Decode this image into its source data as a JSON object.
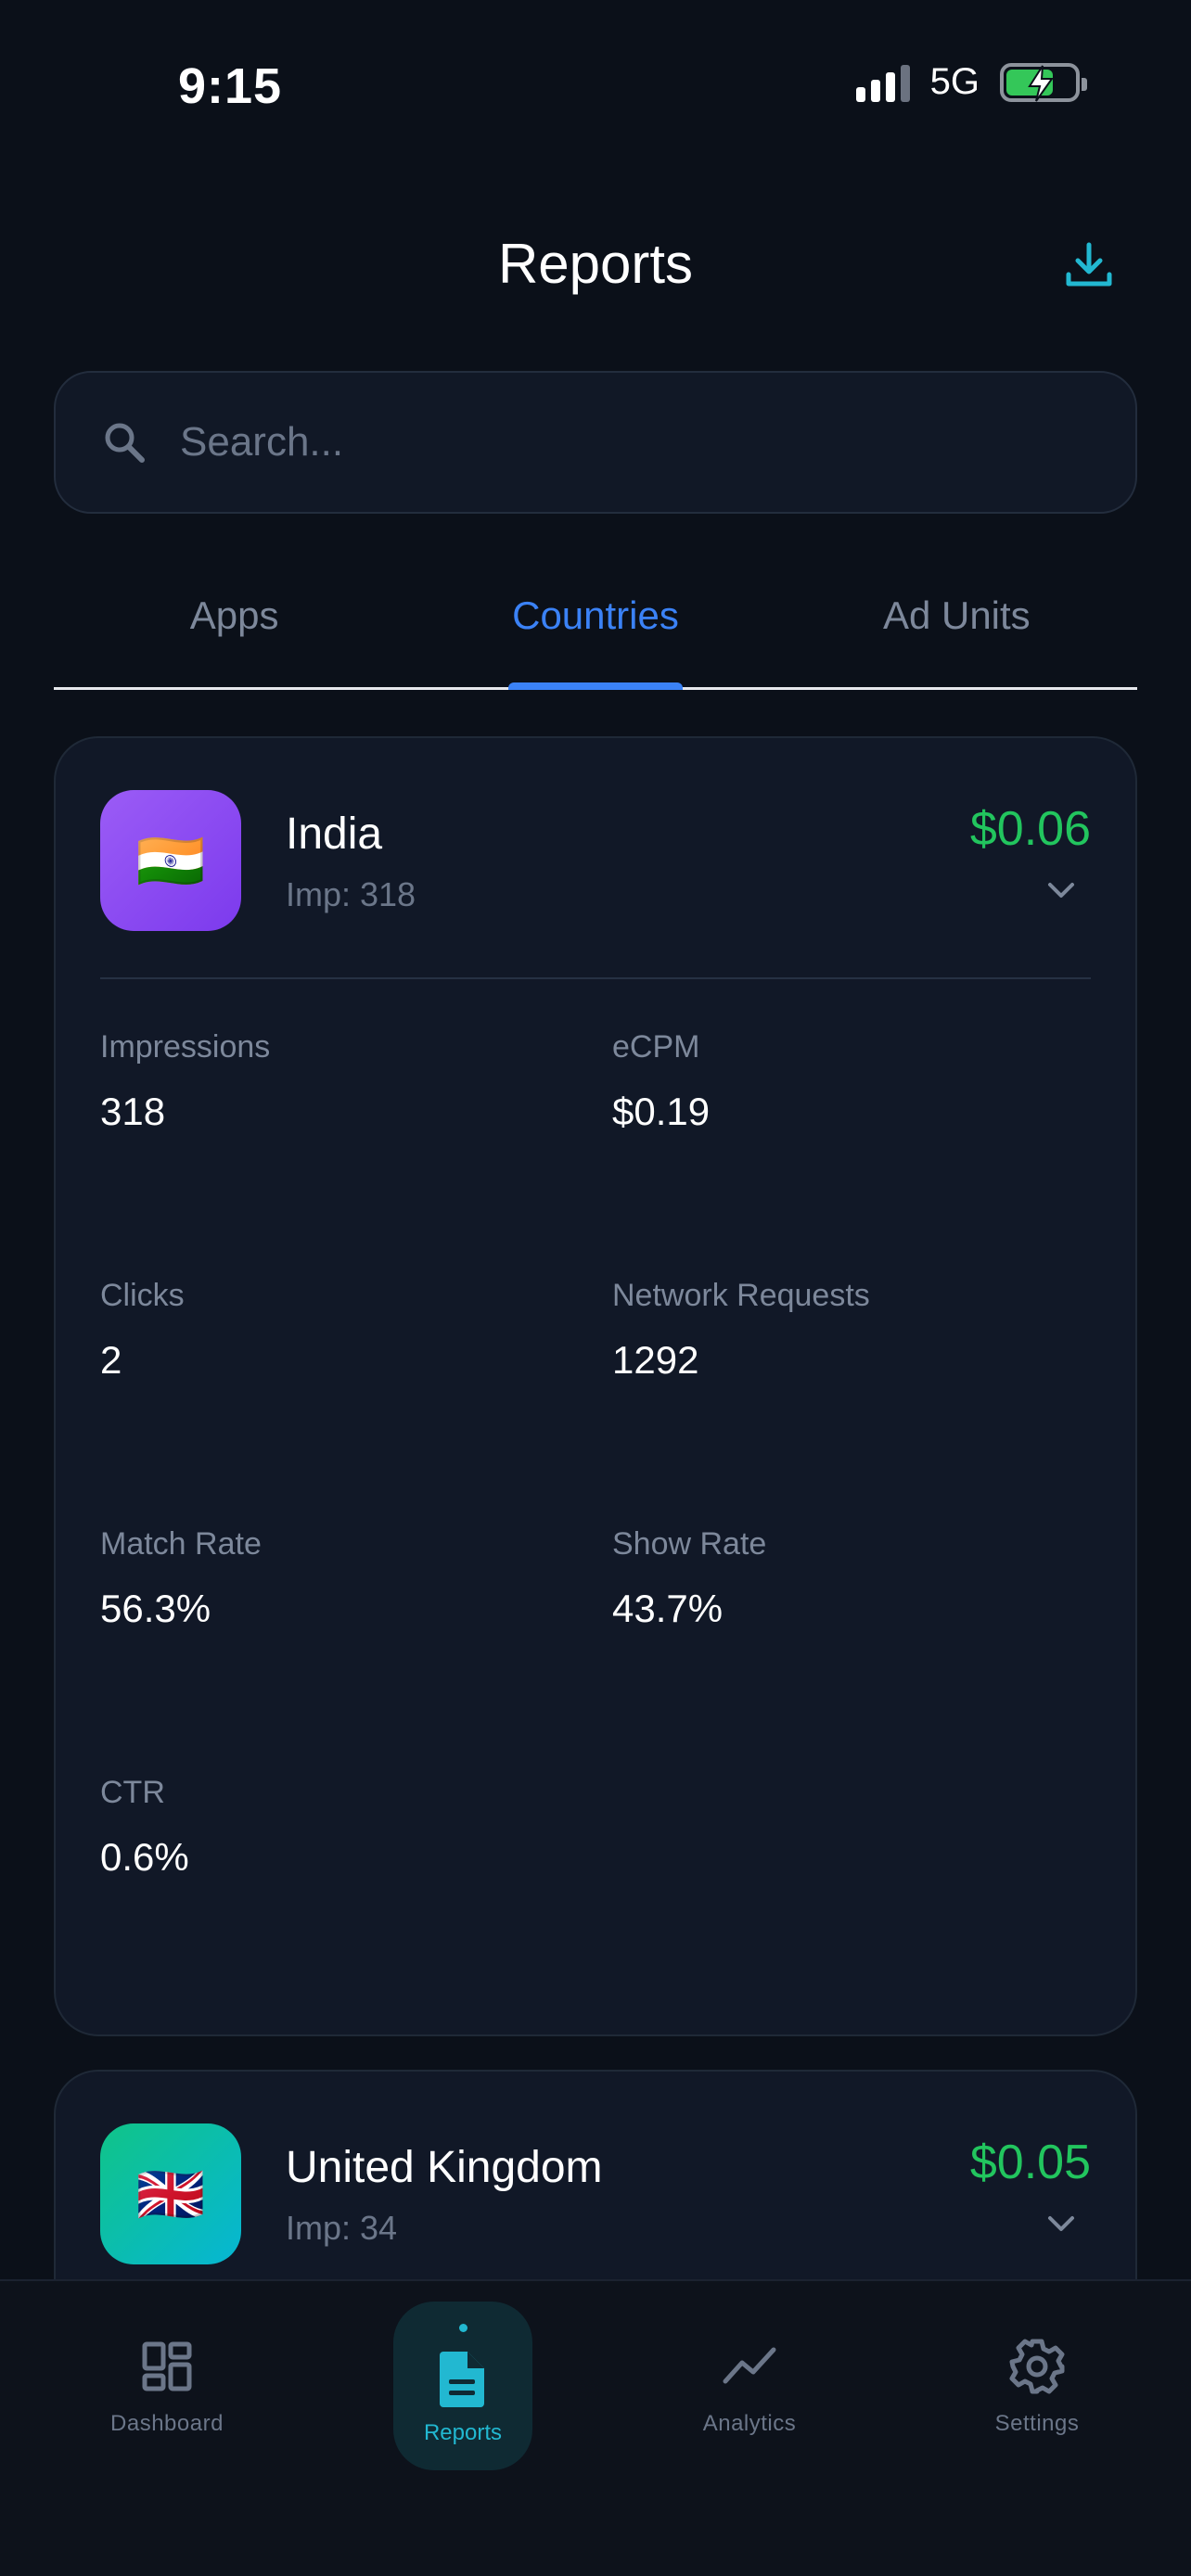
{
  "status_bar": {
    "time": "9:15",
    "network": "5G"
  },
  "header": {
    "title": "Reports"
  },
  "search": {
    "placeholder": "Search..."
  },
  "tabs": [
    {
      "label": "Apps",
      "active": false
    },
    {
      "label": "Countries",
      "active": true
    },
    {
      "label": "Ad Units",
      "active": false
    }
  ],
  "cards": [
    {
      "name": "India",
      "flag": "🇮🇳",
      "impressions_summary": "Imp: 318",
      "revenue": "$0.06",
      "expanded": true,
      "metrics": [
        {
          "label": "Impressions",
          "value": "318"
        },
        {
          "label": "eCPM",
          "value": "$0.19"
        },
        {
          "label": "Clicks",
          "value": "2"
        },
        {
          "label": "Network Requests",
          "value": "1292"
        },
        {
          "label": "Match Rate",
          "value": "56.3%"
        },
        {
          "label": "Show Rate",
          "value": "43.7%"
        },
        {
          "label": "CTR",
          "value": "0.6%"
        }
      ]
    },
    {
      "name": "United Kingdom",
      "flag": "🇬🇧",
      "impressions_summary": "Imp: 34",
      "revenue": "$0.05",
      "expanded": false
    }
  ],
  "bottom_nav": [
    {
      "label": "Dashboard",
      "icon": "dashboard-icon",
      "active": false
    },
    {
      "label": "Reports",
      "icon": "document-icon",
      "active": true
    },
    {
      "label": "Analytics",
      "icon": "trend-line-icon",
      "active": false
    },
    {
      "label": "Settings",
      "icon": "gear-icon",
      "active": false
    }
  ],
  "colors": {
    "background": "#0b1019",
    "card": "#111827",
    "accent_blue": "#3b82f6",
    "revenue_green": "#22c55e",
    "nav_active": "#22b8d1"
  }
}
